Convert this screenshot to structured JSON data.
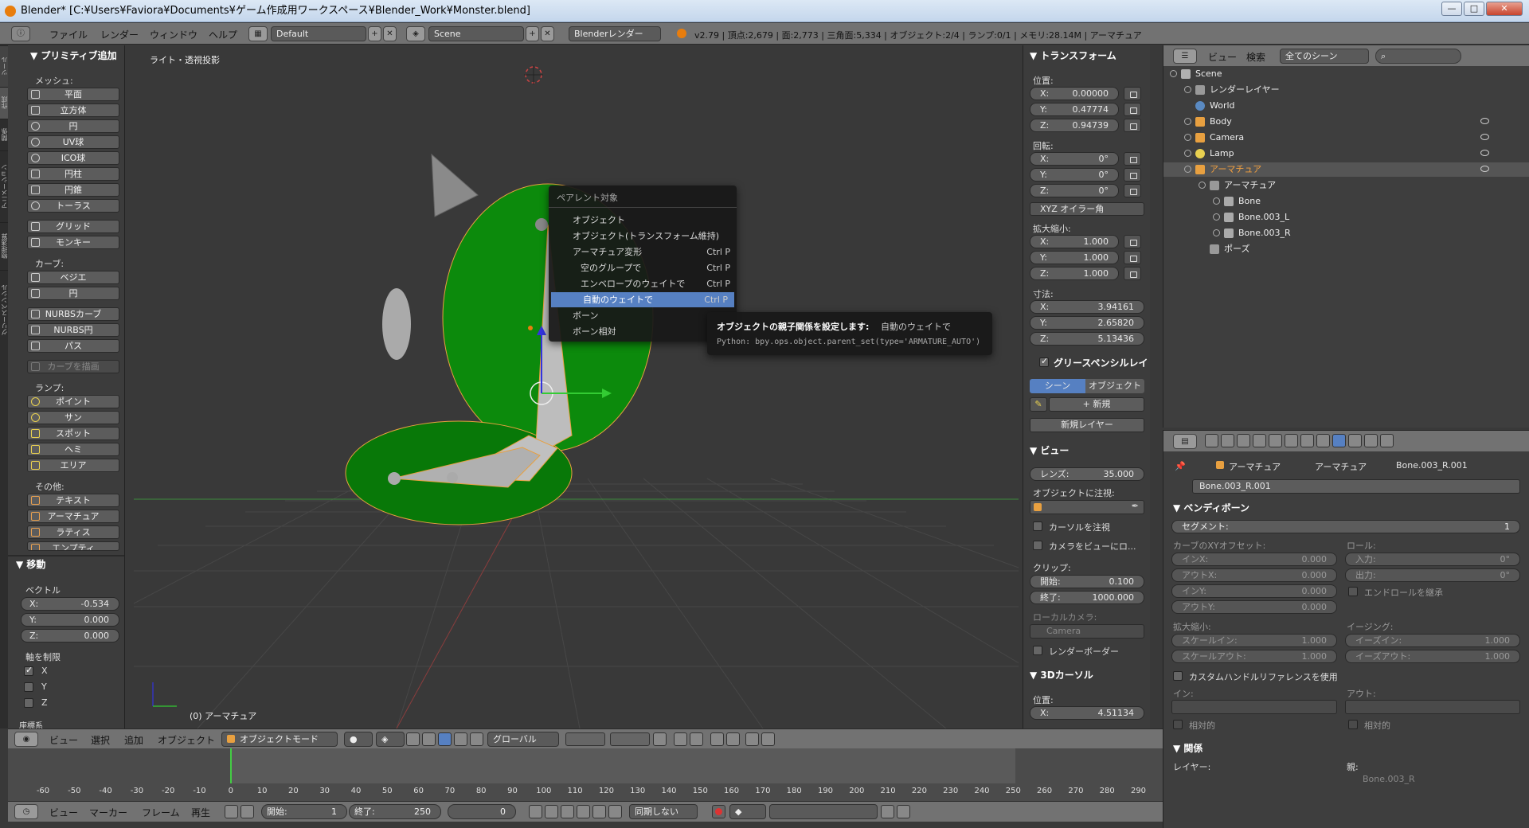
{
  "window": {
    "title": "Blender* [C:¥Users¥Faviora¥Documents¥ゲーム作成用ワークスペース¥Blender_Work¥Monster.blend]",
    "min": "—",
    "max": "□",
    "close": "✕"
  },
  "menubar": {
    "items": [
      "ファイル",
      "レンダー",
      "ウィンドウ",
      "ヘルプ"
    ],
    "layout": "Default",
    "scene": "Scene",
    "engine": "Blenderレンダー",
    "stats": "v2.79 | 頂点:2,679 | 面:2,773 | 三角面:5,334 | オブジェクト:2/4 | ランプ:0/1 | メモリ:28.14M | アーマチュア"
  },
  "tool_tabs": [
    "ツール",
    "作成",
    "関係",
    "アニメーション",
    "物理演算",
    "グリースペンシル"
  ],
  "tools": {
    "header": "▼ プリミティブ追加",
    "mesh_label": "メッシュ:",
    "mesh": [
      "平面",
      "立方体",
      "円",
      "UV球",
      "ICO球",
      "円柱",
      "円錐",
      "トーラス"
    ],
    "mesh2": [
      "グリッド",
      "モンキー"
    ],
    "curve_label": "カーブ:",
    "curve": [
      "ベジエ",
      "円"
    ],
    "curve2": [
      "NURBSカーブ",
      "NURBS円",
      "パス"
    ],
    "draw_curve": "カーブを描画",
    "lamp_label": "ランプ:",
    "lamp": [
      "ポイント",
      "サン",
      "スポット",
      "ヘミ",
      "エリア"
    ],
    "other_label": "その他:",
    "other": [
      "テキスト",
      "アーマチュア",
      "ラティス",
      "エンプティ"
    ]
  },
  "move": {
    "header": "▼ 移動",
    "vector_label": "ベクトル",
    "x": "-0.534",
    "y": "0.000",
    "z": "0.000",
    "constraint_label": "軸を制限",
    "axes": [
      "X",
      "Y",
      "Z"
    ],
    "more": "座標系"
  },
  "viewport": {
    "label": "ライト・透視投影",
    "object_label": "(0) アーマチュア"
  },
  "parent_menu": {
    "title": "ペアレント対象",
    "items": [
      {
        "label": "オブジェクト",
        "shortcut": ""
      },
      {
        "label": "オブジェクト(トランスフォーム維持)",
        "shortcut": ""
      },
      {
        "label": "アーマチュア変形",
        "shortcut": "Ctrl P"
      },
      {
        "label": "空のグループで",
        "shortcut": "Ctrl P"
      },
      {
        "label": "エンベロープのウェイトで",
        "shortcut": "Ctrl P"
      },
      {
        "label": "自動のウェイトで",
        "shortcut": "Ctrl P"
      },
      {
        "label": "ボーン",
        "shortcut": ""
      },
      {
        "label": "ボーン相対",
        "shortcut": ""
      }
    ]
  },
  "tooltip": {
    "title": "オブジェクトの親子関係を設定します:",
    "sub": "自動のウェイトで",
    "python": "Python: bpy.ops.object.parent_set(type='ARMATURE_AUTO')"
  },
  "transform": {
    "header": "▼ トランスフォーム",
    "loc_label": "位置:",
    "loc": [
      "X:",
      "0.00000",
      "Y:",
      "0.47774",
      "Z:",
      "0.94739"
    ],
    "rot_label": "回転:",
    "rot": [
      "X:",
      "0°",
      "Y:",
      "0°",
      "Z:",
      "0°"
    ],
    "rot_mode": "XYZ オイラー角",
    "scale_label": "拡大縮小:",
    "scale": [
      "X:",
      "1.000",
      "Y:",
      "1.000",
      "Z:",
      "1.000"
    ],
    "dim_label": "寸法:",
    "dim": [
      "X:",
      "3.94161",
      "Y:",
      "2.65820",
      "Z:",
      "5.13436"
    ]
  },
  "grease": {
    "header": "グリースペンシルレイ",
    "scene_tab": "シーン",
    "object_tab": "オブジェクト",
    "new": "新規",
    "new_layer": "新規レイヤー"
  },
  "view": {
    "header": "▼ ビュー",
    "lens": "レンズ:",
    "lens_val": "35.000",
    "lock_label": "オブジェクトに注視:",
    "lock_cursor": "カーソルを注視",
    "lock_camera": "カメラをビューにロ...",
    "clip_label": "クリップ:",
    "clip_start": "開始:",
    "clip_start_val": "0.100",
    "clip_end": "終了:",
    "clip_end_val": "1000.000",
    "local_cam": "ローカルカメラ:",
    "camera": "Camera",
    "render_border": "レンダーボーダー"
  },
  "cursor3d": {
    "header": "▼ 3Dカーソル",
    "pos_label": "位置:",
    "x": "X:",
    "x_val": "4.51134"
  },
  "outliner": {
    "view": "ビュー",
    "search": "検索",
    "filter": "全てのシーン",
    "rows": [
      "Scene",
      "レンダーレイヤー",
      "World",
      "Body",
      "Camera",
      "Lamp",
      "アーマチュア",
      "アーマチュア",
      "Bone",
      "Bone.003_L",
      "Bone.003_R",
      "ポーズ"
    ]
  },
  "properties": {
    "path": [
      "アーマチュア",
      "アーマチュア",
      "Bone.003_R.001"
    ],
    "bone_name": "Bone.003_R.001",
    "bendy_header": "▼ ベンディボーン",
    "segments": "セグメント:",
    "segments_val": "1",
    "curve_off": "カーブのXYオフセット:",
    "roll": "ロール:",
    "in_x": "インX:",
    "out_x": "アウトX:",
    "in_y": "インY:",
    "out_y": "アウトY:",
    "roll_in": "入力:",
    "roll_out": "出力:",
    "zero": "0.000",
    "deg": "0°",
    "inherit_roll": "エンドロールを継承",
    "scale_label": "拡大縮小:",
    "ease_label": "イージング:",
    "scale_in": "スケールイン:",
    "scale_out": "スケールアウト:",
    "ease_in": "イーズイン:",
    "ease_out": "イーズアウト:",
    "one": "1.000",
    "custom_handle": "カスタムハンドルリファレンスを使用",
    "in": "イン:",
    "out": "アウト:",
    "relative": "相対的",
    "rel_header": "▼ 関係",
    "layer": "レイヤー:",
    "parent": "親:",
    "parent_val": "Bone.003_R"
  },
  "view3d_header": {
    "menus": [
      "ビュー",
      "選択",
      "追加",
      "オブジェクト"
    ],
    "mode": "オブジェクトモード",
    "orientation": "グローバル"
  },
  "timeline": {
    "ticks": [
      "-60",
      "-50",
      "-40",
      "-30",
      "-20",
      "-10",
      "0",
      "10",
      "20",
      "30",
      "40",
      "50",
      "60",
      "70",
      "80",
      "90",
      "100",
      "110",
      "120",
      "130",
      "140",
      "150",
      "160",
      "170",
      "180",
      "190",
      "200",
      "210",
      "220",
      "230",
      "240",
      "250",
      "260",
      "270",
      "280",
      "290"
    ]
  },
  "timeline_header": {
    "menus": [
      "ビュー",
      "マーカー",
      "フレーム",
      "再生"
    ],
    "start": "開始:",
    "start_val": "1",
    "end": "終了:",
    "end_val": "250",
    "current": "0",
    "sync": "同期しない"
  }
}
